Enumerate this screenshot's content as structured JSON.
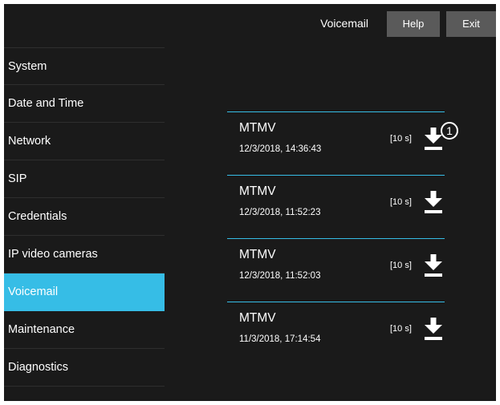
{
  "header": {
    "title": "Voicemail",
    "help_label": "Help",
    "exit_label": "Exit"
  },
  "sidebar": {
    "items": [
      {
        "label": "System"
      },
      {
        "label": "Date and Time"
      },
      {
        "label": "Network"
      },
      {
        "label": "SIP"
      },
      {
        "label": "Credentials"
      },
      {
        "label": "IP video cameras"
      },
      {
        "label": "Voicemail",
        "active": true
      },
      {
        "label": "Maintenance"
      },
      {
        "label": "Diagnostics"
      }
    ]
  },
  "voicemails": [
    {
      "name": "MTMV",
      "date": "12/3/2018, 14:36:43",
      "duration": "[10 s]",
      "icon": "download-icon"
    },
    {
      "name": "MTMV",
      "date": "12/3/2018, 11:52:23",
      "duration": "[10 s]",
      "icon": "download-icon"
    },
    {
      "name": "MTMV",
      "date": "12/3/2018, 11:52:03",
      "duration": "[10 s]",
      "icon": "download-icon"
    },
    {
      "name": "MTMV",
      "date": "11/3/2018, 17:14:54",
      "duration": "[10 s]",
      "icon": "download-icon"
    }
  ],
  "callout": {
    "label": "1"
  },
  "colors": {
    "accent": "#36bde6",
    "background": "#1a1a1a",
    "button": "#5a5a5a"
  }
}
